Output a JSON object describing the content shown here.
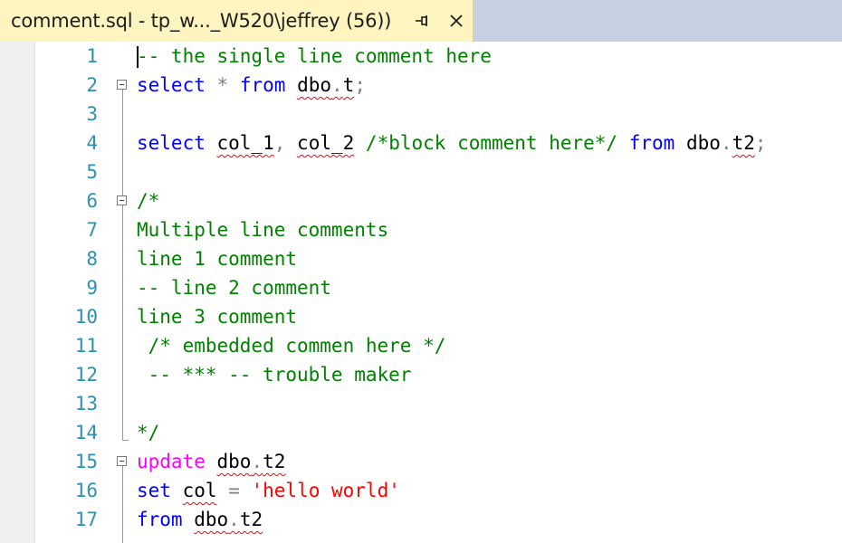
{
  "tab": {
    "title": "comment.sql - tp_w..._W520\\jeffrey (56))",
    "pin_icon": "pin-icon",
    "close_icon": "close-icon"
  },
  "colors": {
    "tab_background": "#fdf4bf",
    "tab_strip_background": "#c7d0e2",
    "line_number": "#2b91af",
    "keyword": "#0000ff",
    "keyword_magenta": "#ff00ff",
    "comment": "#008000",
    "string": "#ff0000",
    "squiggle": "#ff0000"
  },
  "editor": {
    "line_numbers": [
      "1",
      "2",
      "3",
      "4",
      "5",
      "6",
      "7",
      "8",
      "9",
      "10",
      "11",
      "12",
      "13",
      "14",
      "15",
      "16",
      "17"
    ],
    "lines": [
      [
        {
          "t": "-- the single line comment here",
          "c": "cmt"
        }
      ],
      [
        {
          "t": "select",
          "c": "kw"
        },
        {
          "t": " ",
          "c": "plain"
        },
        {
          "t": "*",
          "c": "punct"
        },
        {
          "t": " ",
          "c": "plain"
        },
        {
          "t": "from",
          "c": "kw"
        },
        {
          "t": " ",
          "c": "plain"
        },
        {
          "t": "dbo",
          "c": "plain",
          "sq": true
        },
        {
          "t": ".",
          "c": "punct",
          "sq": true
        },
        {
          "t": "t",
          "c": "plain",
          "sq": true
        },
        {
          "t": ";",
          "c": "punct"
        }
      ],
      [],
      [
        {
          "t": "select",
          "c": "kw"
        },
        {
          "t": " ",
          "c": "plain"
        },
        {
          "t": "col_1",
          "c": "plain",
          "sq": true
        },
        {
          "t": ",",
          "c": "punct"
        },
        {
          "t": " ",
          "c": "plain"
        },
        {
          "t": "col_2",
          "c": "plain",
          "sq": true
        },
        {
          "t": " ",
          "c": "plain"
        },
        {
          "t": "/*block comment here*/",
          "c": "cmt"
        },
        {
          "t": " ",
          "c": "plain"
        },
        {
          "t": "from",
          "c": "kw"
        },
        {
          "t": " ",
          "c": "plain"
        },
        {
          "t": "dbo",
          "c": "plain"
        },
        {
          "t": ".",
          "c": "punct"
        },
        {
          "t": "t2",
          "c": "plain",
          "sq": true
        },
        {
          "t": ";",
          "c": "punct"
        }
      ],
      [],
      [
        {
          "t": "/*",
          "c": "cmt"
        }
      ],
      [
        {
          "t": "Multiple line comments",
          "c": "cmt"
        }
      ],
      [
        {
          "t": "line 1 comment",
          "c": "cmt"
        }
      ],
      [
        {
          "t": "-- line 2 comment",
          "c": "cmt"
        }
      ],
      [
        {
          "t": "line 3 comment",
          "c": "cmt"
        }
      ],
      [
        {
          "t": " /* embedded commen here */",
          "c": "cmt"
        }
      ],
      [
        {
          "t": " -- *** -- trouble maker",
          "c": "cmt"
        }
      ],
      [],
      [
        {
          "t": "*/",
          "c": "cmt"
        }
      ],
      [
        {
          "t": "update",
          "c": "kw-magenta"
        },
        {
          "t": " ",
          "c": "plain"
        },
        {
          "t": "dbo",
          "c": "plain",
          "sq": true
        },
        {
          "t": ".",
          "c": "punct",
          "sq": true
        },
        {
          "t": "t2",
          "c": "plain",
          "sq": true
        }
      ],
      [
        {
          "t": "set",
          "c": "kw"
        },
        {
          "t": " ",
          "c": "plain"
        },
        {
          "t": "col",
          "c": "plain",
          "sq": true
        },
        {
          "t": " ",
          "c": "plain"
        },
        {
          "t": "=",
          "c": "punct"
        },
        {
          "t": " ",
          "c": "plain"
        },
        {
          "t": "'hello world'",
          "c": "str"
        }
      ],
      [
        {
          "t": "from",
          "c": "kw"
        },
        {
          "t": " ",
          "c": "plain"
        },
        {
          "t": "dbo",
          "c": "plain",
          "sq": true
        },
        {
          "t": ".",
          "c": "punct",
          "sq": true
        },
        {
          "t": "t2",
          "c": "plain",
          "sq": true
        }
      ]
    ]
  }
}
